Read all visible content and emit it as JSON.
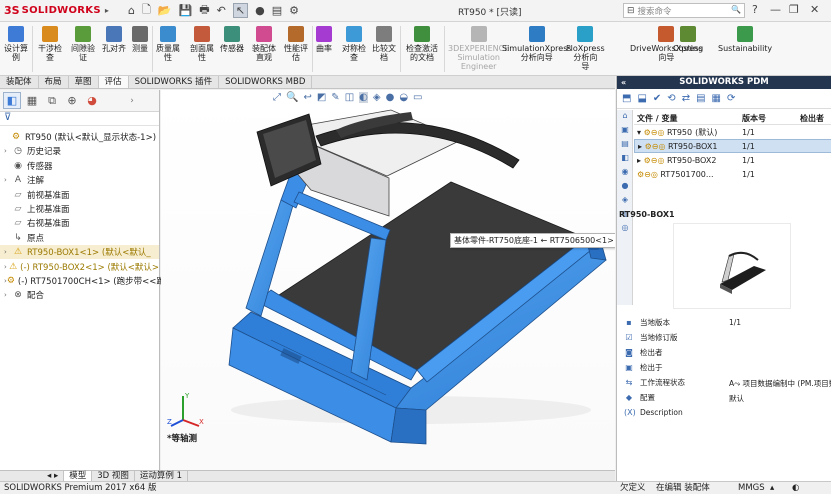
{
  "app": {
    "logo_ds": "3S",
    "logo_text": "SOLIDWORKS",
    "doc_title": "RT950 * [只读]",
    "search_placeholder": "搜索命令"
  },
  "ribbon": [
    {
      "label": "设计算\n例",
      "icon": "design-table-icon",
      "color": "#3d7bd6"
    },
    {
      "label": "干涉检\n查",
      "icon": "interference-icon",
      "color": "#d98b1d"
    },
    {
      "label": "间隙验\n证",
      "icon": "clearance-icon",
      "color": "#5a9b3b"
    },
    {
      "label": "孔对齐",
      "icon": "hole-align-icon",
      "color": "#4a77b8"
    },
    {
      "label": "测量",
      "icon": "measure-icon",
      "color": "#6a6a6a"
    },
    {
      "label": "质量属\n性",
      "icon": "mass-props-icon",
      "color": "#3b8ccf"
    },
    {
      "label": "剖面属\n性",
      "icon": "section-props-icon",
      "color": "#c25a3b"
    },
    {
      "label": "传感器",
      "icon": "sensor-icon",
      "color": "#3c8f7a"
    },
    {
      "label": "装配体\n直观",
      "icon": "assembly-visual-icon",
      "color": "#d04b8f"
    },
    {
      "label": "性能评\n估",
      "icon": "performance-icon",
      "color": "#b46a2a"
    },
    {
      "label": "曲率",
      "icon": "curvature-icon",
      "color": "#a63bd1"
    },
    {
      "label": "对称检\n查",
      "icon": "symmetry-icon",
      "color": "#3d9ad6"
    },
    {
      "label": "比较文\n档",
      "icon": "compare-icon",
      "color": "#7d7d7d"
    },
    {
      "label": "检查激活\n的文档",
      "icon": "check-doc-icon",
      "color": "#3f8f3f"
    },
    {
      "label": "3DEXPERIENCE\nSimulation\nEngineer",
      "icon": "3dx-icon",
      "color": "#b5b5b5",
      "dim": true
    },
    {
      "label": "SimulationXpress\n分析向导",
      "icon": "simxpress-icon",
      "color": "#2e7cc4"
    },
    {
      "label": "FloXpress\n分析向\n导",
      "icon": "floxpress-icon",
      "color": "#2aa0c9"
    },
    {
      "label": "DriveWorksXpress\n向导",
      "icon": "driveworks-icon",
      "color": "#c45a2e"
    },
    {
      "label": "Costing",
      "icon": "costing-icon",
      "color": "#5d8a33"
    },
    {
      "label": "Sustainability",
      "icon": "sustainability-icon",
      "color": "#3c9a4d"
    }
  ],
  "tabs": [
    "装配体",
    "布局",
    "草图",
    "评估",
    "SOLIDWORKS 插件",
    "SOLIDWORKS MBD"
  ],
  "active_tab": "评估",
  "tree": [
    {
      "label": "RT950  (默认<默认_显示状态-1>)",
      "level": 0,
      "expand": "",
      "icon": "assembly-icon"
    },
    {
      "label": "历史记录",
      "level": 1,
      "expand": "›",
      "icon": "history-icon"
    },
    {
      "label": "传感器",
      "level": 1,
      "expand": "",
      "icon": "sensor-icon"
    },
    {
      "label": "注解",
      "level": 1,
      "expand": "›",
      "icon": "annotation-icon"
    },
    {
      "label": "前视基准面",
      "level": 1,
      "expand": "",
      "icon": "plane-icon"
    },
    {
      "label": "上视基准面",
      "level": 1,
      "expand": "",
      "icon": "plane-icon"
    },
    {
      "label": "右视基准面",
      "level": 1,
      "expand": "",
      "icon": "plane-icon"
    },
    {
      "label": "原点",
      "level": 1,
      "expand": "",
      "icon": "origin-icon"
    },
    {
      "label": "RT950-BOX1<1> (默认<默认_",
      "level": 1,
      "expand": "›",
      "icon": "warning-icon",
      "selected": true,
      "warn": true
    },
    {
      "label": "(-) RT950-BOX2<1> (默认<默认>",
      "level": 1,
      "expand": "›",
      "icon": "warning-icon",
      "warn": true
    },
    {
      "label": "(-) RT7501700CH<1> (跑步带<<跑",
      "level": 1,
      "expand": "›",
      "icon": "part-icon"
    },
    {
      "label": "配合",
      "level": 1,
      "expand": "›",
      "icon": "mates-icon"
    }
  ],
  "bottom_tabs": [
    "模型",
    "3D 视图",
    "运动算例 1"
  ],
  "viewport": {
    "tooltip": "基体零件-RT750底座-1 ← RT7506500<1>",
    "view_label": "*等轴测"
  },
  "pdm": {
    "title": "SOLIDWORKS PDM",
    "columns": [
      "文件 / 变量",
      "版本号",
      "检出者"
    ],
    "rows": [
      {
        "name": "RT950",
        "extra": "(默认)",
        "version": "1/1",
        "selected": false
      },
      {
        "name": "RT950-BOX1",
        "extra": "",
        "version": "1/1",
        "selected": true
      },
      {
        "name": "RT950-BOX2",
        "extra": "",
        "version": "1/1",
        "selected": false
      },
      {
        "name": "RT7501700...",
        "extra": "",
        "version": "1/1",
        "selected": false
      }
    ],
    "preview_title": "RT950-BOX1",
    "props": [
      {
        "label": "当地版本",
        "value": "1/1",
        "icon": "version-icon"
      },
      {
        "label": "当地修订版",
        "value": "",
        "icon": "revision-icon"
      },
      {
        "label": "检出者",
        "value": "",
        "icon": "checkout-user-icon"
      },
      {
        "label": "检出于",
        "value": "",
        "icon": "checkout-at-icon"
      },
      {
        "label": "工作流程状态",
        "value": "项目数据编制中 (PM.项目数...",
        "icon": "workflow-icon"
      },
      {
        "label": "配置",
        "value": "默认",
        "icon": "config-icon"
      },
      {
        "label": "Description",
        "value": "",
        "icon": "description-icon"
      }
    ]
  },
  "status": {
    "left": "SOLIDWORKS Premium 2017 x64 版",
    "undefined": "欠定义",
    "editing": "在编辑 装配体",
    "units": "MMGS"
  },
  "colors": {
    "accent": "#3d7bd6",
    "pdm_header": "#243550",
    "model_blue": "#3c8de6",
    "warning": "#c48a00"
  }
}
